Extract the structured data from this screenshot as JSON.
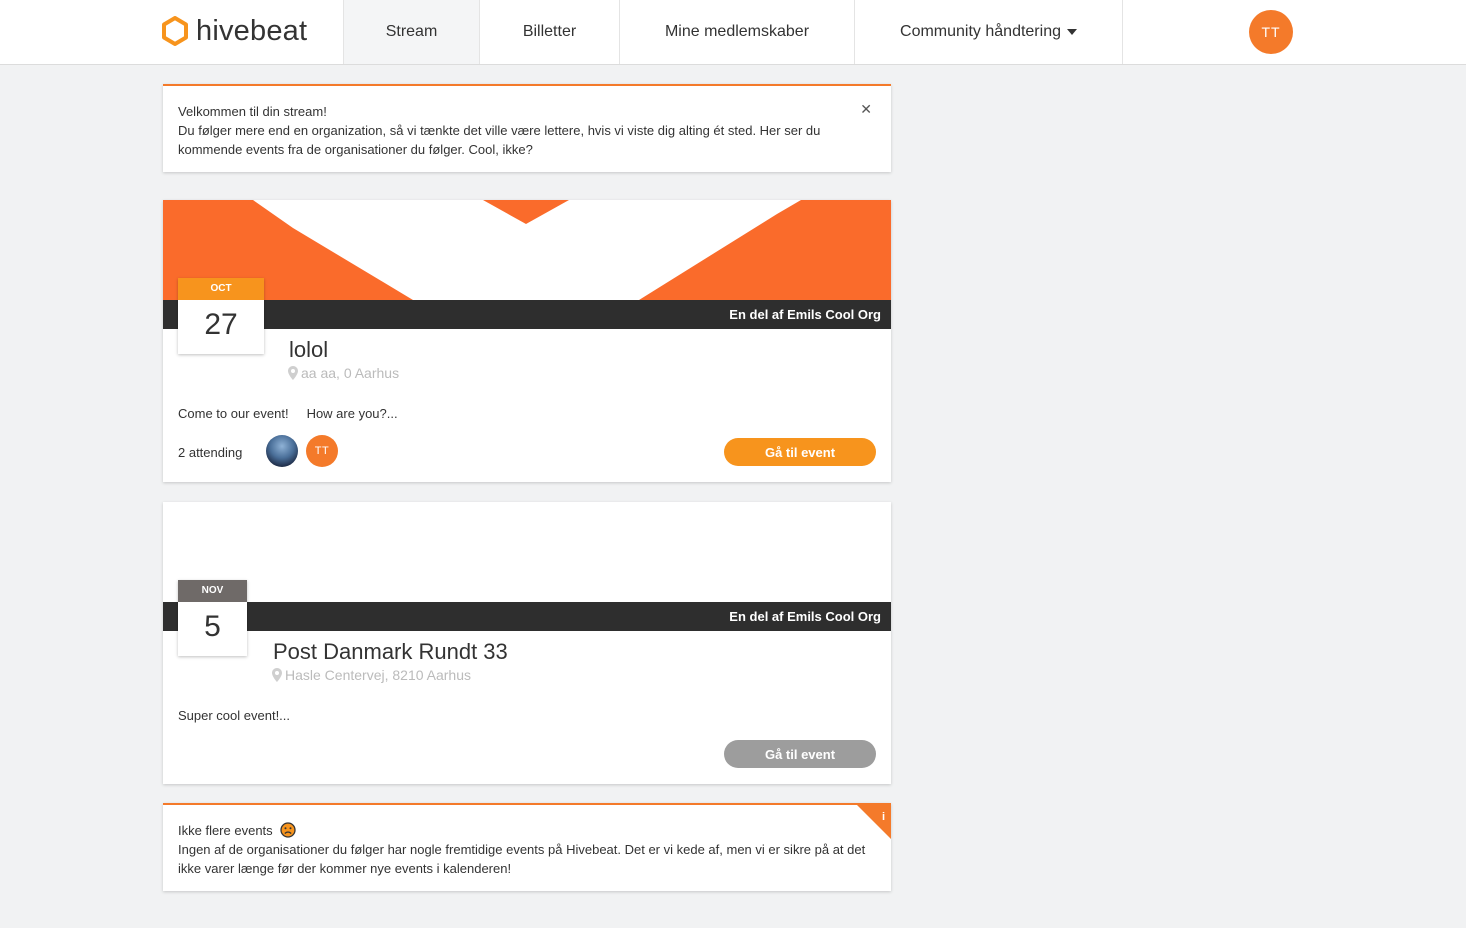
{
  "app": {
    "logo_text": "hivebeat",
    "accent": "#f47a2a",
    "button_orange": "#f7941d"
  },
  "nav": {
    "items": [
      {
        "label": "Stream"
      },
      {
        "label": "Billetter"
      },
      {
        "label": "Mine medlemskaber"
      },
      {
        "label": "Community håndtering"
      }
    ],
    "active": "Stream",
    "avatar": "TT"
  },
  "welcome": {
    "title": "Velkommen til din stream!",
    "body": "Du følger mere end en organization, så vi tænkte det ville være lettere, hvis vi viste dig alting ét sted. Her ser du kommende events fra de organisationer du følger. Cool, ikke?"
  },
  "events": [
    {
      "org": "En del af Emils Cool Org",
      "month": "OCT",
      "day": "27",
      "title": "lolol",
      "location": "aa aa, 0 Aarhus",
      "desc1": "Come to our event!",
      "desc2": "How are you?...",
      "attending": "2 attending",
      "attendee_initials": "TT",
      "button": "Gå til event"
    },
    {
      "org": "En del af Emils Cool Org",
      "month": "NOV",
      "day": "5",
      "title": "Post Danmark Rundt 33",
      "location": "Hasle Centervej, 8210 Aarhus",
      "desc1": "Super cool event!...",
      "button": "Gå til event"
    }
  ],
  "nomore": {
    "title": "Ikke flere events",
    "body": "Ingen af de organisationer du følger har nogle fremtidige events på Hivebeat. Det er vi kede af, men vi er sikre på at det ikke varer længe før der kommer nye events i kalenderen!",
    "corner_icon": "i"
  }
}
